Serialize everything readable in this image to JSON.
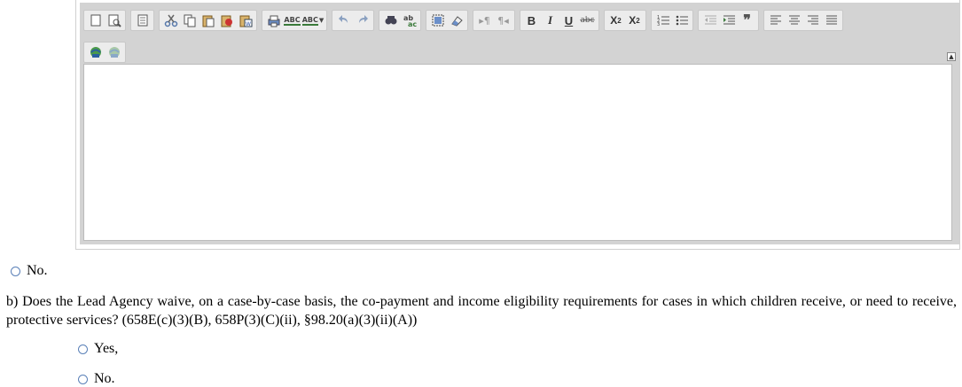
{
  "toolbar": {
    "row1": [
      {
        "group": "document",
        "buttons": [
          {
            "name": "new-page-icon",
            "label": ""
          },
          {
            "name": "preview-icon",
            "label": ""
          }
        ]
      },
      {
        "group": "templates",
        "buttons": [
          {
            "name": "templates-icon",
            "label": ""
          }
        ]
      },
      {
        "group": "clipboard",
        "buttons": [
          {
            "name": "cut-icon",
            "label": ""
          },
          {
            "name": "copy-icon",
            "label": ""
          },
          {
            "name": "paste-icon",
            "label": ""
          },
          {
            "name": "paste-text-icon",
            "label": ""
          },
          {
            "name": "paste-word-icon",
            "label": ""
          }
        ]
      },
      {
        "group": "print-spell",
        "buttons": [
          {
            "name": "print-icon",
            "label": ""
          },
          {
            "name": "spellcheck-icon",
            "label": "ABC"
          },
          {
            "name": "spellcheck-dropdown-icon",
            "label": "ABC"
          }
        ]
      },
      {
        "group": "undo",
        "buttons": [
          {
            "name": "undo-icon",
            "label": ""
          },
          {
            "name": "redo-icon",
            "label": ""
          }
        ]
      },
      {
        "group": "find",
        "buttons": [
          {
            "name": "find-icon",
            "label": ""
          },
          {
            "name": "replace-icon",
            "label": ""
          }
        ]
      },
      {
        "group": "select",
        "buttons": [
          {
            "name": "select-all-icon",
            "label": ""
          },
          {
            "name": "remove-format-icon",
            "label": ""
          }
        ]
      },
      {
        "group": "direction",
        "buttons": [
          {
            "name": "ltr-icon",
            "label": "▸¶"
          },
          {
            "name": "rtl-icon",
            "label": "¶◂"
          }
        ]
      },
      {
        "group": "basic-styles",
        "buttons": [
          {
            "name": "bold-icon",
            "label": "B"
          },
          {
            "name": "italic-icon",
            "label": "I"
          },
          {
            "name": "underline-icon",
            "label": "U"
          },
          {
            "name": "strike-icon",
            "label": "abc"
          }
        ]
      },
      {
        "group": "script",
        "buttons": [
          {
            "name": "subscript-icon",
            "label": "X"
          },
          {
            "name": "superscript-icon",
            "label": "X"
          }
        ]
      },
      {
        "group": "lists",
        "buttons": [
          {
            "name": "numbered-list-icon",
            "label": ""
          },
          {
            "name": "bulleted-list-icon",
            "label": ""
          }
        ]
      },
      {
        "group": "indent",
        "buttons": [
          {
            "name": "outdent-icon",
            "label": ""
          },
          {
            "name": "indent-icon",
            "label": ""
          },
          {
            "name": "blockquote-icon",
            "label": "❞"
          }
        ]
      },
      {
        "group": "align",
        "buttons": [
          {
            "name": "align-left-icon",
            "label": ""
          },
          {
            "name": "align-center-icon",
            "label": ""
          },
          {
            "name": "align-right-icon",
            "label": ""
          },
          {
            "name": "align-justify-icon",
            "label": ""
          }
        ]
      }
    ],
    "row2": [
      {
        "group": "links",
        "buttons": [
          {
            "name": "link-icon",
            "label": ""
          },
          {
            "name": "unlink-icon",
            "label": ""
          }
        ]
      }
    ],
    "collapse_label": "▲"
  },
  "options_top": [
    {
      "label": "No."
    }
  ],
  "question": {
    "text": "b) Does the Lead Agency waive, on a case-by-case basis, the co-payment and income eligibility requirements for cases in which children receive, or need to receive, protective services? (658E(c)(3)(B), 658P(3)(C)(ii), §98.20(a)(3)(ii)(A))"
  },
  "options": [
    {
      "label": "Yes,"
    },
    {
      "label": "No."
    }
  ]
}
